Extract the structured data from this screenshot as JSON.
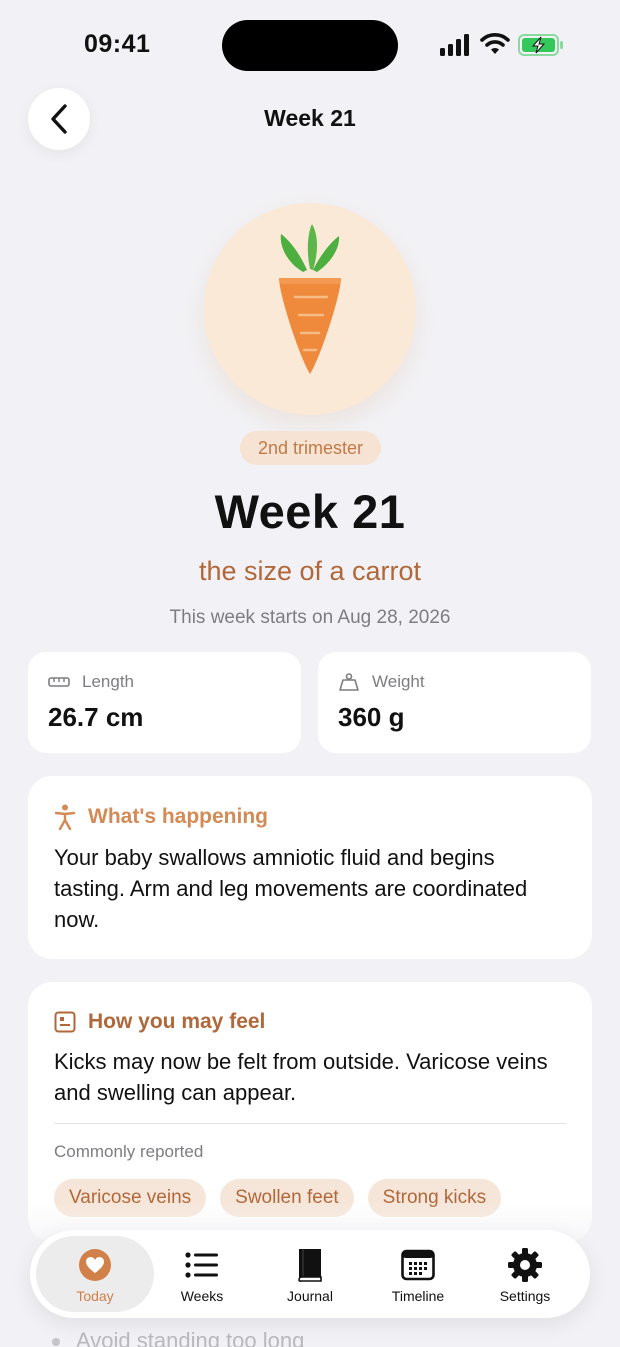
{
  "status_bar": {
    "time": "09:41"
  },
  "header": {
    "title": "Week 21"
  },
  "hero": {
    "trimester": "2nd trimester",
    "week": "Week 21",
    "size_text": "the size of a carrot",
    "start_date": "This week starts on Aug 28, 2026"
  },
  "stats": {
    "length": {
      "label": "Length",
      "value": "26.7 cm"
    },
    "weight": {
      "label": "Weight",
      "value": "360 g"
    }
  },
  "happening": {
    "title": "What's happening",
    "body": "Your baby swallows amniotic fluid and begins tasting. Arm and leg movements are coordinated now."
  },
  "feel": {
    "title": "How you may feel",
    "body": "Kicks may now be felt from outside. Varicose veins and swelling can appear.",
    "reported_label": "Commonly reported",
    "tags": [
      "Varicose veins",
      "Swollen feet",
      "Strong kicks"
    ]
  },
  "peek": {
    "text": "Avoid standing too long"
  },
  "tabbar": {
    "items": [
      {
        "label": "Today",
        "icon": "heart-icon"
      },
      {
        "label": "Weeks",
        "icon": "list-icon"
      },
      {
        "label": "Journal",
        "icon": "book-icon"
      },
      {
        "label": "Timeline",
        "icon": "calendar-icon"
      },
      {
        "label": "Settings",
        "icon": "gear-icon"
      }
    ],
    "active": "Today"
  },
  "colors": {
    "accent": "#d2804a",
    "accent_dark": "#b0683a",
    "background": "#f2f2f6",
    "card": "#ffffff"
  }
}
